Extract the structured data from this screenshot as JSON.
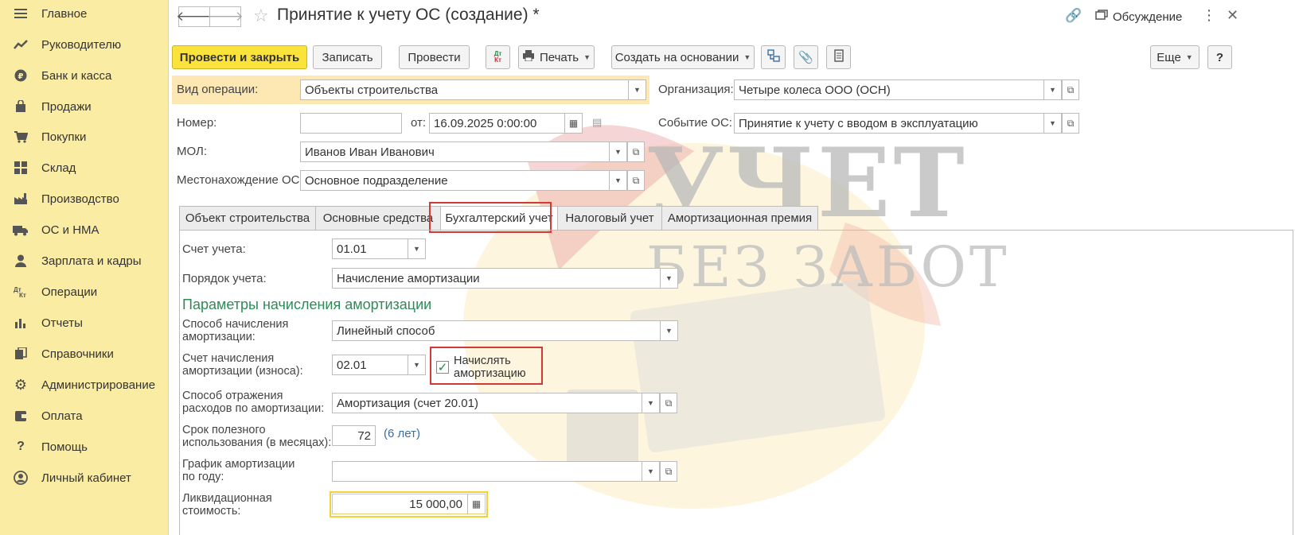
{
  "sidebar": {
    "items": [
      {
        "label": "Главное",
        "icon": "menu-icon"
      },
      {
        "label": "Руководителю",
        "icon": "trend-icon"
      },
      {
        "label": "Банк и касса",
        "icon": "coin-icon"
      },
      {
        "label": "Продажи",
        "icon": "bag-icon"
      },
      {
        "label": "Покупки",
        "icon": "cart-icon"
      },
      {
        "label": "Склад",
        "icon": "warehouse-icon"
      },
      {
        "label": "Производство",
        "icon": "factory-icon"
      },
      {
        "label": "ОС и НМА",
        "icon": "truck-icon"
      },
      {
        "label": "Зарплата и кадры",
        "icon": "person-icon"
      },
      {
        "label": "Операции",
        "icon": "dt-kt-icon"
      },
      {
        "label": "Отчеты",
        "icon": "bar-chart-icon"
      },
      {
        "label": "Справочники",
        "icon": "books-icon"
      },
      {
        "label": "Администрирование",
        "icon": "gear-icon"
      },
      {
        "label": "Оплата",
        "icon": "wallet-icon"
      },
      {
        "label": "Помощь",
        "icon": "question-icon"
      },
      {
        "label": "Личный кабинет",
        "icon": "user-circle-icon"
      }
    ]
  },
  "header": {
    "title": "Принятие к учету ОС (создание) *",
    "discussion": "Обсуждение"
  },
  "toolbar": {
    "post_close": "Провести и закрыть",
    "save": "Записать",
    "post": "Провести",
    "dtkt": "Дт\nКт",
    "print": "Печать",
    "create_based": "Создать на основании",
    "more": "Еще",
    "help": "?"
  },
  "form": {
    "op_type_label": "Вид операции:",
    "op_type_value": "Объекты строительства",
    "org_label": "Организация:",
    "org_value": "Четыре колеса ООО (ОСН)",
    "number_label": "Номер:",
    "number_value": "",
    "from_label": "от:",
    "date_value": "16.09.2025  0:00:00",
    "event_label": "Событие ОС:",
    "event_value": "Принятие к учету с вводом в эксплуатацию",
    "mol_label": "МОЛ:",
    "mol_value": "Иванов Иван Иванович",
    "location_label": "Местонахождение ОС:",
    "location_value": "Основное подразделение"
  },
  "tabs": [
    "Объект строительства",
    "Основные средства",
    "Бухгалтерский учет",
    "Налоговый учет",
    "Амортизационная премия"
  ],
  "accounting": {
    "account_label": "Счет учета:",
    "account_value": "01.01",
    "order_label": "Порядок учета:",
    "order_value": "Начисление амортизации",
    "section_title": "Параметры начисления амортизации",
    "method_label_1": "Способ начисления",
    "method_label_2": "амортизации:",
    "method_value": "Линейный способ",
    "dep_account_label_1": "Счет начисления",
    "dep_account_label_2": "амортизации (износа):",
    "dep_account_value": "02.01",
    "accrue_label_1": "Начислять",
    "accrue_label_2": "амортизацию",
    "accrue_checked": true,
    "reflect_label_1": "Способ отражения",
    "reflect_label_2": "расходов по амортизации:",
    "reflect_value": "Амортизация (счет 20.01)",
    "life_label_1": "Срок полезного",
    "life_label_2": "использования (в месяцах):",
    "life_value": "72",
    "life_years": "(6 лет)",
    "schedule_label_1": "График амортизации",
    "schedule_label_2": "по году:",
    "schedule_value": "",
    "liquidation_label_1": "Ликвидационная",
    "liquidation_label_2": "стоимость:",
    "liquidation_value": "15 000,00"
  },
  "watermark": {
    "line1": "УЧЕТ",
    "line2": "БЕЗ ЗАБОТ"
  }
}
